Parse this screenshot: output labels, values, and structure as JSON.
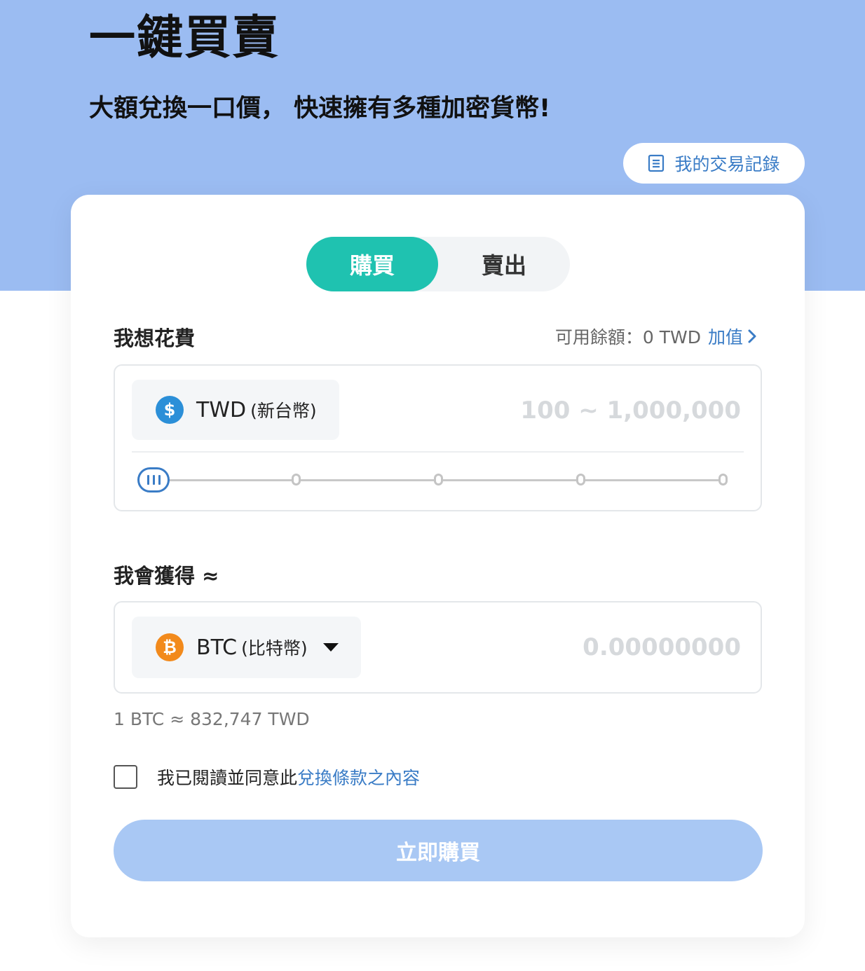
{
  "header": {
    "title": "一鍵買賣",
    "subtitle": "大額兌換一口價， 快速擁有多種加密貨幣!",
    "history_button": "我的交易記錄"
  },
  "tabs": {
    "buy": "購買",
    "sell": "賣出",
    "active": "buy"
  },
  "spend": {
    "label": "我想花費",
    "balance_label": "可用餘額：0 TWD",
    "topup_label": "加值",
    "currency_code": "TWD",
    "currency_name": "(新台幣)",
    "amount_placeholder": "100 ~ 1,000,000",
    "slider": {
      "value": 0,
      "tick_count": 5
    }
  },
  "receive": {
    "label": "我會獲得 ≈",
    "currency_code": "BTC",
    "currency_name": "(比特幣)",
    "amount_placeholder": "0.00000000"
  },
  "rate_text": "1 BTC ≈ 832,747 TWD",
  "agreement": {
    "text": "我已閱讀並同意此",
    "link": "兌換條款之內容",
    "checked": false
  },
  "submit_label": "立即購買",
  "icons": {
    "twd": "dollar-sign-icon",
    "btc": "bitcoin-icon",
    "history": "document-list-icon",
    "topup": "chevron-right-icon",
    "dropdown": "caret-down-icon"
  },
  "colors": {
    "hero_bg": "#9bbcf2",
    "accent_teal": "#1fc2b0",
    "link_blue": "#3a7cc6",
    "submit_disabled": "#a9c8f4",
    "btc_orange": "#f28a1c",
    "twd_blue": "#2b8fd8"
  }
}
